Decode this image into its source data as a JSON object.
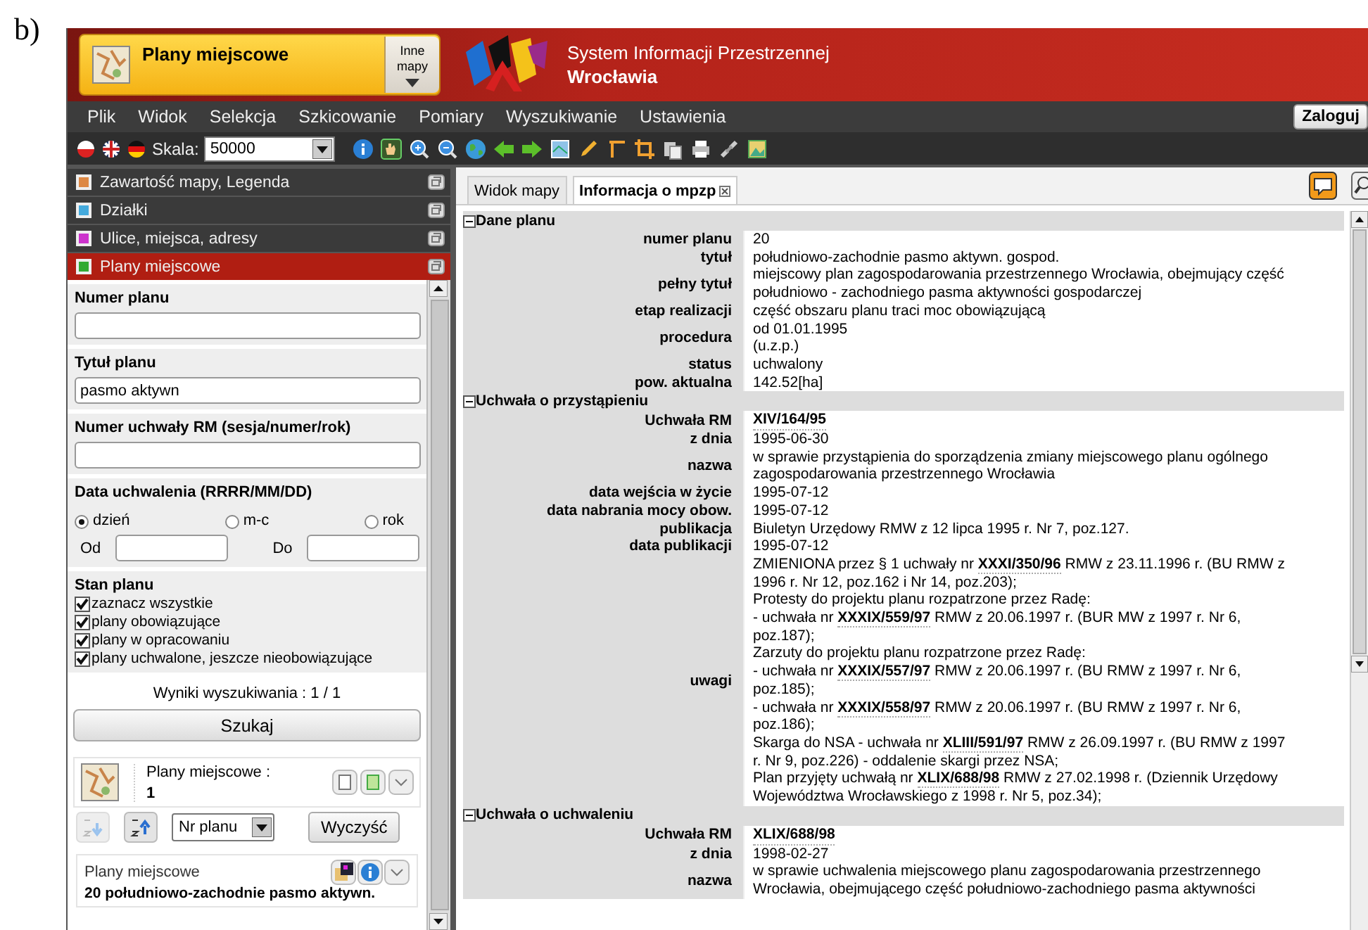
{
  "figure_label": "b)",
  "header": {
    "app_title": "Plany miejscowe",
    "other_maps": "Inne mapy",
    "system_title": "System Informacji Przestrzennej",
    "city": "Wrocławia"
  },
  "menu": [
    "Plik",
    "Widok",
    "Selekcja",
    "Szkicowanie",
    "Pomiary",
    "Wyszukiwanie",
    "Ustawienia"
  ],
  "login_button": "Zaloguj",
  "toolbar": {
    "scale_label": "Skala:",
    "scale_value": "50000"
  },
  "accordion": [
    {
      "label": "Zawartość mapy, Legenda",
      "selected": false
    },
    {
      "label": "Działki",
      "selected": false
    },
    {
      "label": "Ulice, miejsca, adresy",
      "selected": false
    },
    {
      "label": "Plany miejscowe",
      "selected": true
    }
  ],
  "search_form": {
    "fields": [
      {
        "label": "Numer planu"
      },
      {
        "label": "Tytuł planu",
        "value": "pasmo aktywn"
      },
      {
        "label": "Numer uchwały RM (sesja/numer/rok)"
      }
    ],
    "date": {
      "label": "Data uchwalenia (RRRR/MM/DD)",
      "options": [
        {
          "label": "dzień",
          "selected": true
        },
        {
          "label": "m-c",
          "selected": false
        },
        {
          "label": "rok",
          "selected": false
        }
      ],
      "from_label": "Od",
      "to_label": "Do"
    },
    "status": {
      "label": "Stan planu",
      "options": [
        {
          "label": "zaznacz wszystkie",
          "checked": true
        },
        {
          "label": "plany obowiązujące",
          "checked": true
        },
        {
          "label": "plany w opracowaniu",
          "checked": true
        },
        {
          "label": "plany uchwalone, jeszcze nieobowiązujące",
          "checked": true
        }
      ]
    },
    "results_count": "Wyniki wyszukiwania : 1 / 1",
    "search_button": "Szukaj"
  },
  "results": {
    "layer": "Plany miejscowe :",
    "count": "1",
    "sort_field": "Nr planu",
    "clear_button": "Wyczyść",
    "items": [
      {
        "layer": "Plany miejscowe",
        "title": "20 południowo-zachodnie pasmo aktywn."
      }
    ]
  },
  "tabs": [
    {
      "label": "Widok mapy",
      "selected": false,
      "closable": false
    },
    {
      "label": "Informacja o mpzp",
      "selected": true,
      "closable": true
    }
  ],
  "sections": [
    {
      "title": "Dane planu",
      "expanded": true,
      "rows": [
        {
          "label": "numer planu",
          "lines": [
            "20"
          ]
        },
        {
          "label": "tytuł",
          "lines": [
            "południowo-zachodnie pasmo aktywn. gospod."
          ]
        },
        {
          "label": "pełny tytuł",
          "lines": [
            "miejscowy plan zagospodarowania przestrzennego Wrocławia, obejmujący część",
            "południowo - zachodniego pasma aktywności gospodarczej"
          ]
        },
        {
          "label": "etap realizacji",
          "lines": [
            "część obszaru planu traci moc obowiązującą"
          ]
        },
        {
          "label": "procedura",
          "lines": [
            "od 01.01.1995",
            "(u.z.p.)"
          ]
        },
        {
          "label": "status",
          "lines": [
            "uchwalony"
          ]
        },
        {
          "label": "pow. aktualna",
          "lines": [
            "142.52[ha]"
          ]
        }
      ]
    },
    {
      "title": "Uchwała o przystąpieniu",
      "expanded": true,
      "rows": [
        {
          "label": "Uchwała RM",
          "kind": "ref",
          "lines": [
            "XIV/164/95"
          ]
        },
        {
          "label": "z dnia",
          "lines": [
            "1995-06-30"
          ]
        },
        {
          "label": "nazwa",
          "lines": [
            "w sprawie przystąpienia do sporządzenia zmiany miejscowego planu ogólnego",
            "zagospodarowania przestrzennego Wrocławia"
          ]
        },
        {
          "label": "data wejścia w życie",
          "lines": [
            "1995-07-12"
          ]
        },
        {
          "label": "data nabrania mocy obow.",
          "lines": [
            "1995-07-12"
          ]
        },
        {
          "label": "publikacja",
          "lines": [
            "Biuletyn Urzędowy RMW z 12 lipca 1995 r. Nr 7, poz.127."
          ]
        },
        {
          "label": "data publikacji",
          "lines": [
            "1995-07-12"
          ]
        },
        {
          "label": "uwagi",
          "lines": [
            "ZMIENIONA przez § 1 uchwały nr **XXXI/350/96** RMW z 23.11.1996 r. (BU RMW z",
            "1996 r. Nr 12, poz.162 i Nr 14, poz.203);",
            "Protesty do projektu planu rozpatrzone przez Radę:",
            "- uchwała nr **XXXIX/559/97** RMW z 20.06.1997 r. (BUR MW z 1997 r. Nr 6,",
            "poz.187);",
            "Zarzuty do projektu planu rozpatrzone przez Radę:",
            "- uchwała nr **XXXIX/557/97** RMW z 20.06.1997 r. (BU RMW z 1997 r. Nr 6,",
            "poz.185);",
            "- uchwała nr **XXXIX/558/97** RMW z 20.06.1997 r. (BU RMW z 1997 r. Nr 6,",
            "poz.186);",
            "Skarga do NSA - uchwała nr **XLIII/591/97** RMW z 26.09.1997 r. (BU RMW z 1997",
            "r. Nr 9, poz.226) - oddalenie skargi przez NSA;",
            "Plan przyjęty uchwałą nr **XLIX/688/98** RMW z 27.02.1998 r. (Dziennik Urzędowy",
            "Województwa Wrocławskiego z 1998 r. Nr 5, poz.34);"
          ]
        }
      ]
    },
    {
      "title": "Uchwała o uchwaleniu",
      "expanded": true,
      "rows": [
        {
          "label": "Uchwała RM",
          "kind": "ref",
          "lines": [
            "XLIX/688/98"
          ]
        },
        {
          "label": "z dnia",
          "lines": [
            "1998-02-27"
          ]
        },
        {
          "label": "nazwa",
          "lines": [
            "w sprawie uchwalenia miejscowego planu zagospodarowania przestrzennego",
            "Wrocławia, obejmującego część południowo-zachodniego pasma aktywności"
          ]
        }
      ]
    }
  ]
}
